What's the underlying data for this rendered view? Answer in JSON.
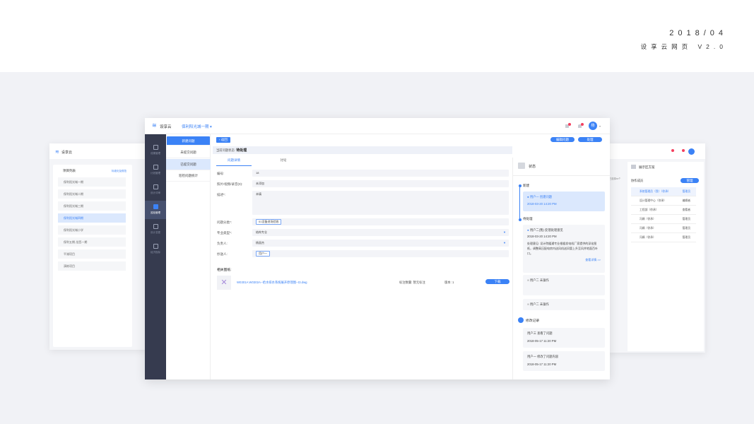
{
  "caption": {
    "date": "2018/04",
    "title": "设享云网页 V2.0"
  },
  "app": {
    "logo": "设享云",
    "project": "保利阳光城一期",
    "avatar": "杨"
  },
  "nav": [
    {
      "label": "成果管理"
    },
    {
      "label": "计划管理"
    },
    {
      "label": "设计评审"
    },
    {
      "label": "巡检管理"
    },
    {
      "label": "设计变更"
    },
    {
      "label": "经济指标"
    }
  ],
  "submenu": [
    {
      "label": "新建问题"
    },
    {
      "label": "未提交问题"
    },
    {
      "label": "已提交问题"
    },
    {
      "label": "巡检问题统计"
    }
  ],
  "content": {
    "back": "返回",
    "status_label": "当前问题状态:",
    "status_value": "待处理",
    "edit_button": "编辑问题",
    "process_button": "处理",
    "tabs": [
      "问题详情",
      "讨论"
    ],
    "fields": [
      {
        "label": "编号:",
        "value": "18"
      },
      {
        "label": "照片/视频/录音(0):",
        "value": "未添加"
      },
      {
        "label": "描述*:",
        "value": "未填"
      },
      {
        "label": "问题分类*:",
        "value": "01设备进场验收"
      },
      {
        "label": "专业类型*:",
        "value": "结构专业"
      },
      {
        "label": "负责人:",
        "value": "杨丽杰"
      },
      {
        "label": "抄送人:",
        "value": "用户一"
      }
    ],
    "drawings_title": "相关图纸:",
    "drawing": {
      "name": "W0301A W0302A--给水排水系统展开原理图--t3.dwg",
      "marks": "标注数量: 暂无标注",
      "version": "版本: 1",
      "download": "下载"
    }
  },
  "status_panel": {
    "title": "状态",
    "stage_new": "新建",
    "new_card": {
      "title": "用户一 创建问题",
      "time": "2018-03-20 14:20 PM"
    },
    "stage_pending": "待处理",
    "pending_card": {
      "title": "用户二(我) 反馈处理意见",
      "time": "2018-03-20 14:20 PM",
      "text": "处理意见: 设计院暖通专业根据发电机厂家提供的深化图纸，调整高压配电房内送风机送风管上升至风井地面百叶口。",
      "more": "查看详情 >>"
    },
    "waiting": [
      "用户二 未操作",
      "用户二 未操作"
    ],
    "log_title": "修改记录",
    "logs": [
      {
        "title": "用户三 查看了问题",
        "time": "2018-05-17 11:20 PM"
      },
      {
        "title": "用户一 修改了问题内容",
        "time": "2018-05-17 11:20 PM"
      }
    ]
  },
  "left_window": {
    "logo": "设享云",
    "list_title": "项目列表",
    "link": "标准化及规范",
    "projects": [
      "保利阳光城一期",
      "保利阳光城二期",
      "保利阳光城三期",
      "保利阳光城四期",
      "保利阳光城小学",
      "保利五期-龙西一期",
      "平湖项目",
      "演练项目"
    ]
  },
  "right_window": {
    "folder": "展示区方案",
    "members_title": "协作成员",
    "manage": "管理",
    "count": "已选择xx个",
    "members": [
      {
        "name": "系统管理员（我）（徐承）",
        "role": "管理员"
      },
      {
        "name": "设计管理中心（徐承）",
        "role": "编辑者"
      },
      {
        "name": "工程部（徐承）",
        "role": "查看者"
      },
      {
        "name": "冯娟（徐承）",
        "role": "管理员"
      },
      {
        "name": "冯娟（徐承）",
        "role": "管理员"
      },
      {
        "name": "冯娟（徐承）",
        "role": "管理员"
      }
    ]
  }
}
